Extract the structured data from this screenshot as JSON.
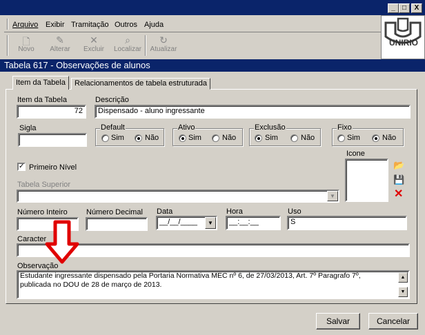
{
  "window": {
    "min_label": "_",
    "max_label": "□",
    "close_label": "X"
  },
  "menu": [
    "Arquivo",
    "Exibir",
    "Tramitação",
    "Outros",
    "Ajuda"
  ],
  "toolbar": [
    {
      "label": "Novo",
      "icon": "new-document-icon",
      "glyph": "🗋"
    },
    {
      "label": "Alterar",
      "icon": "edit-icon",
      "glyph": "✎"
    },
    {
      "label": "Excluir",
      "icon": "delete-icon",
      "glyph": "✕"
    },
    {
      "label": "Localizar",
      "icon": "binoculars-icon",
      "glyph": "⌕"
    },
    {
      "label": "Atualizar",
      "icon": "refresh-icon",
      "glyph": "↻"
    }
  ],
  "logo": {
    "text": "UNIRIO"
  },
  "caption": "Tabela 617 - Observações de alunos",
  "tabs": [
    "Item da Tabela",
    "Relacionamentos de tabela estruturada"
  ],
  "fields": {
    "item_label": "Item da Tabela",
    "item_value": "72",
    "descricao_label": "Descrição",
    "descricao_value": "Dispensado - aluno ingressante",
    "sigla_label": "Sigla",
    "sigla_value": "",
    "primeiro_nivel_label": "Primeiro Nível",
    "primeiro_nivel_checked": true,
    "tabela_superior_label": "Tabela Superior",
    "icone_label": "Icone",
    "numero_inteiro_label": "Número Inteiro",
    "numero_decimal_label": "Número Decimal",
    "data_label": "Data",
    "data_value": "__/__/____",
    "hora_label": "Hora",
    "hora_value": "__:__:__",
    "uso_label": "Uso",
    "uso_value": "S",
    "caracter_label": "Caracter",
    "observacao_label": "Observação",
    "observacao_line1": "Estudante ingressante dispensado pela Portaria Normativa MEC nº 6,  de 27/03/2013, Art. 7º Paragrafo 7º,",
    "observacao_line2": "publicada no DOU de 28 de março de 2013."
  },
  "groups": [
    {
      "title": "Default",
      "selected": "Não"
    },
    {
      "title": "Ativo",
      "selected": "Sim"
    },
    {
      "title": "Exclusão",
      "selected": "Sim"
    },
    {
      "title": "Fixo",
      "selected": "Não"
    }
  ],
  "radio_labels": {
    "sim": "Sim",
    "nao": "Não"
  },
  "buttons": {
    "save": "Salvar",
    "cancel": "Cancelar"
  },
  "colors": {
    "titlebar": "#0a246a",
    "face": "#d4d0c8",
    "annotation_arrow": "#e00000"
  }
}
